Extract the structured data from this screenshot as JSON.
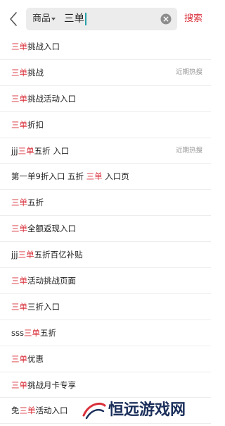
{
  "search": {
    "category": "商品",
    "query": "三单",
    "submit_label": "搜索"
  },
  "suggestions": [
    {
      "parts": [
        {
          "t": "三单",
          "hl": true
        },
        {
          "t": "挑战入口",
          "hl": false
        }
      ],
      "tag": ""
    },
    {
      "parts": [
        {
          "t": "三单",
          "hl": true
        },
        {
          "t": "挑战",
          "hl": false
        }
      ],
      "tag": "近期热搜"
    },
    {
      "parts": [
        {
          "t": "三单",
          "hl": true
        },
        {
          "t": "挑战活动入口",
          "hl": false
        }
      ],
      "tag": ""
    },
    {
      "parts": [
        {
          "t": "三单",
          "hl": true
        },
        {
          "t": "折扣",
          "hl": false
        }
      ],
      "tag": ""
    },
    {
      "parts": [
        {
          "t": "jjj",
          "hl": false
        },
        {
          "t": "三单",
          "hl": true
        },
        {
          "t": "五折 入口",
          "hl": false
        }
      ],
      "tag": "近期热搜"
    },
    {
      "parts": [
        {
          "t": "第一单9折入口 五折 ",
          "hl": false
        },
        {
          "t": "三单",
          "hl": true
        },
        {
          "t": " 入口页",
          "hl": false
        }
      ],
      "tag": ""
    },
    {
      "parts": [
        {
          "t": "三单",
          "hl": true
        },
        {
          "t": "五折",
          "hl": false
        }
      ],
      "tag": ""
    },
    {
      "parts": [
        {
          "t": "三单",
          "hl": true
        },
        {
          "t": "全额返现入口",
          "hl": false
        }
      ],
      "tag": ""
    },
    {
      "parts": [
        {
          "t": "jjj",
          "hl": false
        },
        {
          "t": "三单",
          "hl": true
        },
        {
          "t": "五折百亿补贴",
          "hl": false
        }
      ],
      "tag": ""
    },
    {
      "parts": [
        {
          "t": "三单",
          "hl": true
        },
        {
          "t": "活动挑战页面",
          "hl": false
        }
      ],
      "tag": ""
    },
    {
      "parts": [
        {
          "t": "三单",
          "hl": true
        },
        {
          "t": "三折入口",
          "hl": false
        }
      ],
      "tag": ""
    },
    {
      "parts": [
        {
          "t": "sss",
          "hl": false
        },
        {
          "t": "三单",
          "hl": true
        },
        {
          "t": "五折",
          "hl": false
        }
      ],
      "tag": ""
    },
    {
      "parts": [
        {
          "t": "三单",
          "hl": true
        },
        {
          "t": "优惠",
          "hl": false
        }
      ],
      "tag": ""
    },
    {
      "parts": [
        {
          "t": "三单",
          "hl": true
        },
        {
          "t": "挑战月卡专享",
          "hl": false
        }
      ],
      "tag": ""
    },
    {
      "parts": [
        {
          "t": "免",
          "hl": false
        },
        {
          "t": "三单",
          "hl": true
        },
        {
          "t": "活动入口",
          "hl": false
        }
      ],
      "tag": ""
    }
  ],
  "watermark": {
    "text": "恒远游戏网"
  },
  "colors": {
    "accent": "#d9303a",
    "search_bg": "#ececec",
    "divider": "#ededed",
    "tag_gray": "#999999"
  },
  "icons": {
    "back": "chevron-left-icon",
    "clear": "clear-circle-icon",
    "dropdown": "caret-down-icon"
  }
}
